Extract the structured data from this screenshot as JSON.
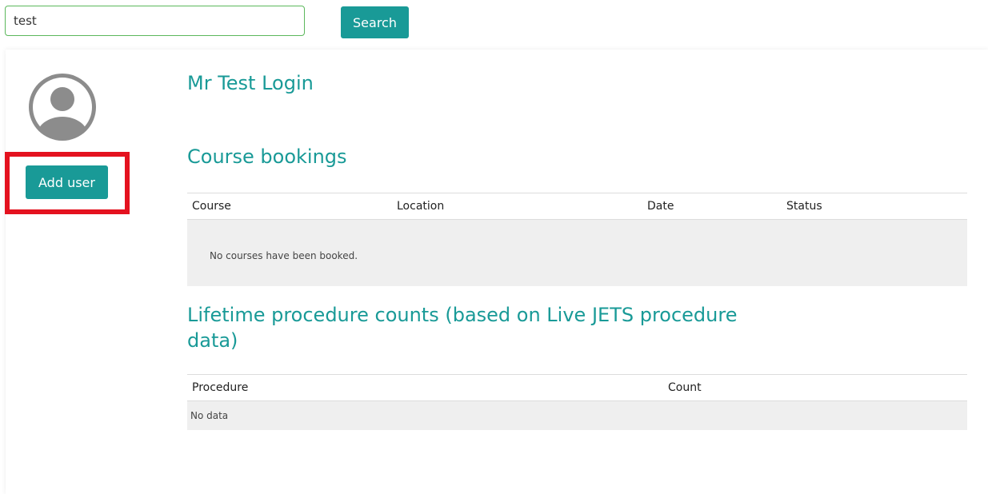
{
  "search": {
    "value": "test",
    "button_label": "Search"
  },
  "profile": {
    "name": "Mr Test Login",
    "add_user_label": "Add user",
    "avatar_icon": "user-avatar-icon"
  },
  "bookings": {
    "title": "Course bookings",
    "columns": [
      "Course",
      "Location",
      "Date",
      "Status"
    ],
    "empty_message": "No courses have been booked."
  },
  "procedures": {
    "title": "Lifetime procedure counts (based on Live JETS procedure data)",
    "columns": [
      "Procedure",
      "Count"
    ],
    "empty_message": "No data"
  },
  "colors": {
    "accent": "#199a97",
    "highlight": "#e4121f",
    "search_border": "#5cb85c"
  }
}
